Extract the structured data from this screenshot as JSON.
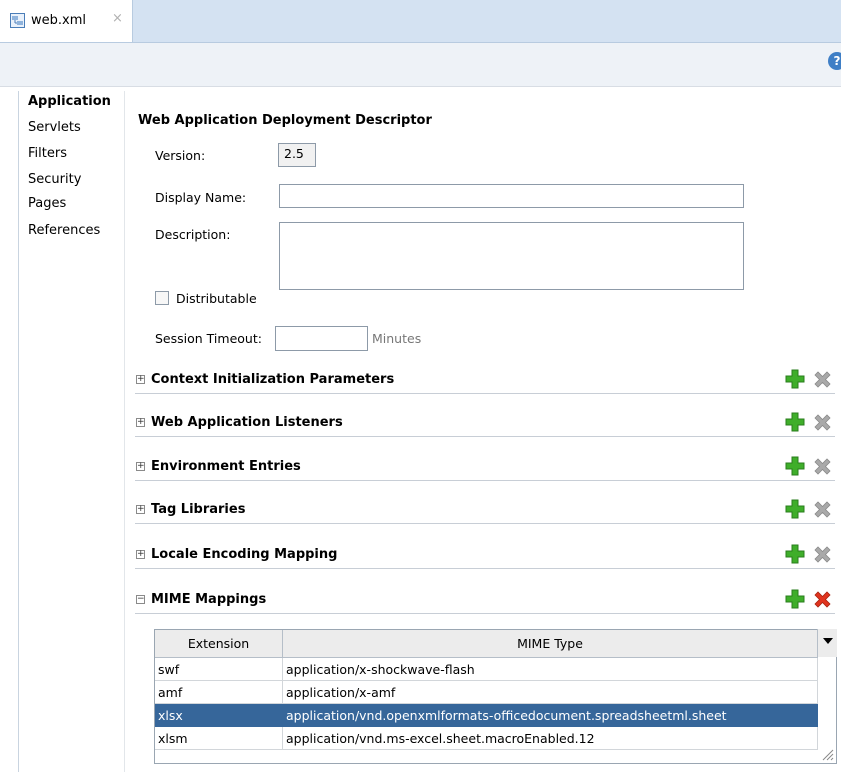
{
  "tab": {
    "title": "web.xml",
    "close_glyph": "×",
    "icon": "xml-file-icon"
  },
  "help": {
    "glyph": "?",
    "icon": "help-icon"
  },
  "nav": {
    "items": [
      {
        "label": "Application",
        "active": true
      },
      {
        "label": "Servlets"
      },
      {
        "label": "Filters"
      },
      {
        "label": "Security"
      },
      {
        "label": "Pages"
      },
      {
        "label": "References"
      }
    ]
  },
  "form": {
    "title": "Web Application Deployment Descriptor",
    "version_label": "Version:",
    "version_value": "2.5",
    "display_name_label": "Display Name:",
    "display_name_value": "",
    "description_label": "Description:",
    "description_value": "",
    "distributable_label": "Distributable",
    "distributable_checked": false,
    "session_timeout_label": "Session Timeout:",
    "session_timeout_value": "",
    "minutes_label": "Minutes"
  },
  "sections": [
    {
      "title": "Context Initialization Parameters",
      "expanded": false,
      "toggle": "+"
    },
    {
      "title": "Web Application Listeners",
      "expanded": false,
      "toggle": "+"
    },
    {
      "title": "Environment Entries",
      "expanded": false,
      "toggle": "+"
    },
    {
      "title": "Tag Libraries",
      "expanded": false,
      "toggle": "+"
    },
    {
      "title": "Locale Encoding Mapping",
      "expanded": false,
      "toggle": "+"
    },
    {
      "title": "MIME Mappings",
      "expanded": true,
      "toggle": "−"
    }
  ],
  "mime_table": {
    "columns": [
      "Extension",
      "MIME Type"
    ],
    "rows": [
      {
        "extension": "swf",
        "mime": "application/x-shockwave-flash"
      },
      {
        "extension": "amf",
        "mime": "application/x-amf"
      },
      {
        "extension": "xlsx",
        "mime": "application/vnd.openxmlformats-officedocument.spreadsheetml.sheet",
        "selected": true
      },
      {
        "extension": "xlsm",
        "mime": "application/vnd.ms-excel.sheet.macroEnabled.12"
      }
    ]
  },
  "colors": {
    "accent": "#36669a",
    "add": "#3fae2a",
    "delete_active": "#d9301c",
    "delete_disabled": "#9b9b9b"
  }
}
